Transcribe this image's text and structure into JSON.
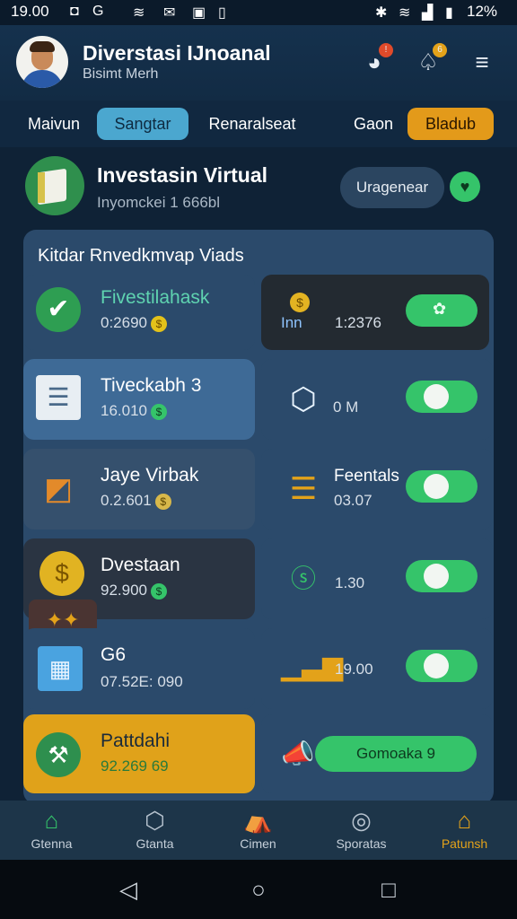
{
  "status_bar": {
    "time": "19.00",
    "battery": "12%",
    "icons": [
      "a-icon",
      "g-icon",
      "wifi-icon",
      "mail-icon",
      "lock-icon",
      "nfc-icon",
      "wifi-icon",
      "signal-icon",
      "battery-icon"
    ]
  },
  "header": {
    "title": "Diverstasi IJnoanal",
    "subtitle": "Bisimt Merh",
    "bell_badge": "!",
    "notif_badge": "6"
  },
  "tabs": [
    {
      "label": "Maivun",
      "active": false
    },
    {
      "label": "Sangtar",
      "active": true
    },
    {
      "label": "Renaralseat",
      "active": false
    },
    {
      "label": "Gaon",
      "active": false
    },
    {
      "label": "Bladub",
      "active": "accent"
    }
  ],
  "profile": {
    "title": "Investasin Virtual",
    "subtitle": "Inyomckei 1 666bl",
    "button": "Uragenear"
  },
  "panel": {
    "title": "Kitdar Rnvedkmvap Viads",
    "left_cards": [
      {
        "title": "Fivestilahask",
        "value": "0:2690",
        "icon": "checkmark-icon"
      },
      {
        "title": "Tiveckabh 3",
        "value": "16.010",
        "icon": "document-icon"
      },
      {
        "title": "Jaye Virbak",
        "value": "0.2.601",
        "icon": "box-icon"
      },
      {
        "title": "Dvestaan",
        "value": "92.900",
        "icon": "coin-icon"
      },
      {
        "title": "G6",
        "value": "07.52E: 090",
        "icon": "calendar-icon"
      },
      {
        "title": "Pattdahi",
        "value": "92.269 69",
        "icon": "tools-icon"
      }
    ],
    "right_cards": [
      {
        "label": "Inn",
        "value": "1:2376",
        "icon": "coin-icon"
      },
      {
        "label": "",
        "value": "0 M",
        "icon": "cube-icon"
      },
      {
        "label": "Feentals",
        "value": "03.07",
        "icon": "stack-icon"
      },
      {
        "label": "",
        "value": "1.30",
        "icon": "dollar-icon"
      },
      {
        "label": "",
        "value": "19.00",
        "icon": "bar-chart-icon"
      },
      {
        "label": "",
        "value": "Gomoaka 9",
        "icon": "horn-icon"
      }
    ]
  },
  "bottom_nav": [
    {
      "label": "Gtenna",
      "icon": "home-icon"
    },
    {
      "label": "Gtanta",
      "icon": "cube-icon"
    },
    {
      "label": "Cimen",
      "icon": "tent-icon"
    },
    {
      "label": "Sporatas",
      "icon": "search-icon"
    },
    {
      "label": "Patunsh",
      "icon": "house-icon"
    }
  ],
  "colors": {
    "bg": "#0f2236",
    "panel": "#2b4a6b",
    "green": "#35c46a",
    "orange": "#e39a1a",
    "blue_tab": "#4ba7cf"
  }
}
